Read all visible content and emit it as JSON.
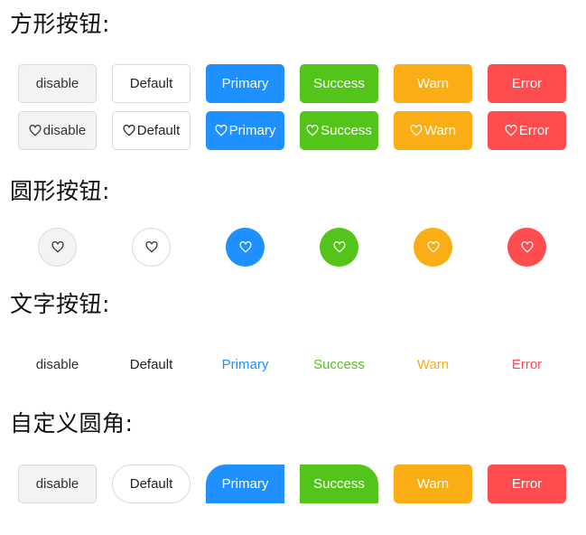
{
  "sections": {
    "square": {
      "title": "方形按钮:"
    },
    "circle": {
      "title": "圆形按钮:"
    },
    "text": {
      "title": "文字按钮:"
    },
    "custom": {
      "title": "自定义圆角:"
    }
  },
  "buttons": {
    "disable": "disable",
    "default": "Default",
    "primary": "Primary",
    "success": "Success",
    "warn": "Warn",
    "error": "Error"
  },
  "icons": {
    "heart": "heart-outline-icon"
  },
  "colors": {
    "primary": "#1e90ff",
    "success": "#52c41a",
    "warn": "#faad14",
    "error": "#ff4d4f",
    "disable_bg": "#f3f3f3",
    "border": "#d9d9d9"
  }
}
